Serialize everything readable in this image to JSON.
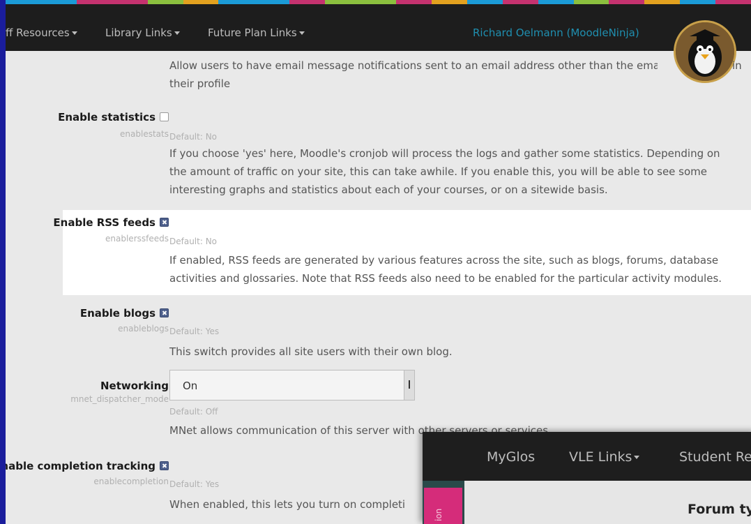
{
  "colorbar": [
    "#1b9bd7",
    "#1b9bd7",
    "#c5326f",
    "#c5326f",
    "#8bbf3e",
    "#e2a11f",
    "#1b9bd7",
    "#1b9bd7",
    "#c5326f",
    "#8bbf3e",
    "#8bbf3e",
    "#c5326f",
    "#e2a11f",
    "#1b9bd7",
    "#c5326f",
    "#1b9bd7",
    "#8bbf3e",
    "#c5326f",
    "#e2a11f",
    "#1b9bd7",
    "#c5326f"
  ],
  "navbar": {
    "items": [
      {
        "label": "ff Resources"
      },
      {
        "label": "Library Links"
      },
      {
        "label": "Future Plan Links"
      }
    ],
    "user": "Richard Oelmann (MoodleNinja)",
    "avatar_icon": "penguin-avatar-icon"
  },
  "settings": {
    "email": {
      "desc": "Allow users to have email message notifications sent to an email address other than the ema",
      "desc_tail": "in",
      "desc_line2": "their profile"
    },
    "stats": {
      "label": "Enable statistics",
      "key": "enablestats",
      "default": "Default: No",
      "checked": false,
      "desc": "If you choose 'yes' here, Moodle's cronjob will process the logs and gather some statistics. Depending on the amount of traffic on your site, this can take awhile. If you enable this, you will be able to see some interesting graphs and statistics about each of your courses, or on a sitewide basis."
    },
    "rss": {
      "label": "Enable RSS feeds",
      "key": "enablerssfeeds",
      "default": "Default: No",
      "checked": true,
      "desc": "If enabled, RSS feeds are generated by various features across the site, such as blogs, forums, database activities and glossaries. Note that RSS feeds also need to be enabled for the particular activity modules."
    },
    "blogs": {
      "label": "Enable blogs",
      "key": "enableblogs",
      "default": "Default: Yes",
      "checked": true,
      "desc": "This switch provides all site users with their own blog."
    },
    "networking": {
      "label": "Networking",
      "key": "mnet_dispatcher_mode",
      "value": "On",
      "default": "Default: Off",
      "desc": "MNet allows communication of this server with other servers or services."
    },
    "completion": {
      "label": "Enable completion tracking",
      "key": "enablecompletion",
      "default": "Default: Yes",
      "checked": true,
      "desc": "When enabled, this lets you turn on completi"
    }
  },
  "overlay": {
    "nav": [
      {
        "label": "MyGlos"
      },
      {
        "label": "VLE Links"
      },
      {
        "label": "Student Re"
      }
    ],
    "side_tab": "ion",
    "forum_title": "Forum ty"
  }
}
